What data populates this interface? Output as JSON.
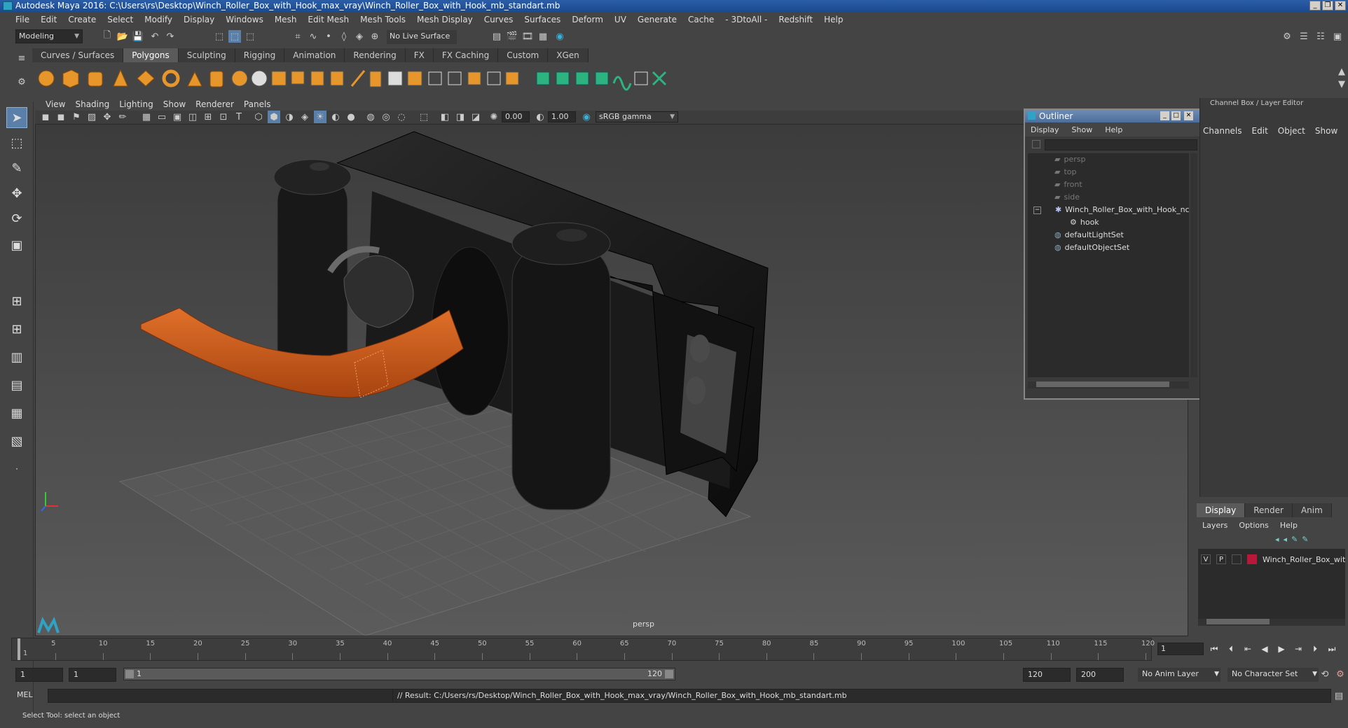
{
  "window": {
    "title": "Autodesk Maya 2016: C:\\Users\\rs\\Desktop\\Winch_Roller_Box_with_Hook_max_vray\\Winch_Roller_Box_with_Hook_mb_standart.mb",
    "buttons": [
      "_",
      "❐",
      "✕"
    ]
  },
  "menubar": [
    "File",
    "Edit",
    "Create",
    "Select",
    "Modify",
    "Display",
    "Windows",
    "Mesh",
    "Edit Mesh",
    "Mesh Tools",
    "Mesh Display",
    "Curves",
    "Surfaces",
    "Deform",
    "UV",
    "Generate",
    "Cache",
    "- 3DtoAll -",
    "Redshift",
    "Help"
  ],
  "statusline": {
    "mode": "Modeling",
    "live_surface": "No Live Surface"
  },
  "shelf": {
    "tabs": [
      "Curves / Surfaces",
      "Polygons",
      "Sculpting",
      "Rigging",
      "Animation",
      "Rendering",
      "FX",
      "FX Caching",
      "Custom",
      "XGen"
    ],
    "active_tab": "Polygons"
  },
  "panel": {
    "menu": [
      "View",
      "Shading",
      "Lighting",
      "Show",
      "Renderer",
      "Panels"
    ],
    "exposure": "0.00",
    "gamma": "1.00",
    "color_space": "sRGB gamma",
    "camera_label": "persp"
  },
  "outliner": {
    "title": "Outliner",
    "menu": [
      "Display",
      "Show",
      "Help"
    ],
    "items": [
      {
        "label": "persp",
        "icon": "camera-icon",
        "dim": true
      },
      {
        "label": "top",
        "icon": "camera-icon",
        "dim": true
      },
      {
        "label": "front",
        "icon": "camera-icon",
        "dim": true
      },
      {
        "label": "side",
        "icon": "camera-icon",
        "dim": true
      },
      {
        "label": "Winch_Roller_Box_with_Hook_nc",
        "icon": "group-icon",
        "dim": false
      },
      {
        "label": "hook",
        "icon": "mesh-icon",
        "dim": false
      },
      {
        "label": "defaultLightSet",
        "icon": "set-icon",
        "dim": false
      },
      {
        "label": "defaultObjectSet",
        "icon": "set-icon",
        "dim": false
      }
    ]
  },
  "channelbox": {
    "title": "Channel Box / Layer Editor",
    "menu": [
      "Channels",
      "Edit",
      "Object",
      "Show"
    ]
  },
  "layers": {
    "tabs": [
      "Display",
      "Render",
      "Anim"
    ],
    "active_tab": "Display",
    "menu": [
      "Layers",
      "Options",
      "Help"
    ],
    "row": {
      "v": "V",
      "p": "P",
      "name": "Winch_Roller_Box_wit",
      "color": "#b8173a"
    }
  },
  "timeline": {
    "ticks": [
      "5",
      "10",
      "15",
      "20",
      "25",
      "30",
      "35",
      "40",
      "45",
      "50",
      "55",
      "60",
      "65",
      "70",
      "75",
      "80",
      "85",
      "90",
      "95",
      "100",
      "105",
      "110",
      "115",
      "120"
    ],
    "start_label": "1",
    "current_frame": "1"
  },
  "range": {
    "start": "1",
    "start2": "1",
    "range_start_label": "1",
    "range_end_label": "120",
    "end": "120",
    "end2": "200",
    "anim_layer": "No Anim Layer",
    "character_set": "No Character Set"
  },
  "command": {
    "lang": "MEL",
    "result": "// Result: C:/Users/rs/Desktop/Winch_Roller_Box_with_Hook_max_vray/Winch_Roller_Box_with_Hook_mb_standart.mb"
  },
  "helpline": "Select Tool: select an object",
  "colors": {
    "strap": "#c85a1e",
    "winch_body": "#141414",
    "grid": "#6a6a6a",
    "layer_color": "#b8173a"
  }
}
